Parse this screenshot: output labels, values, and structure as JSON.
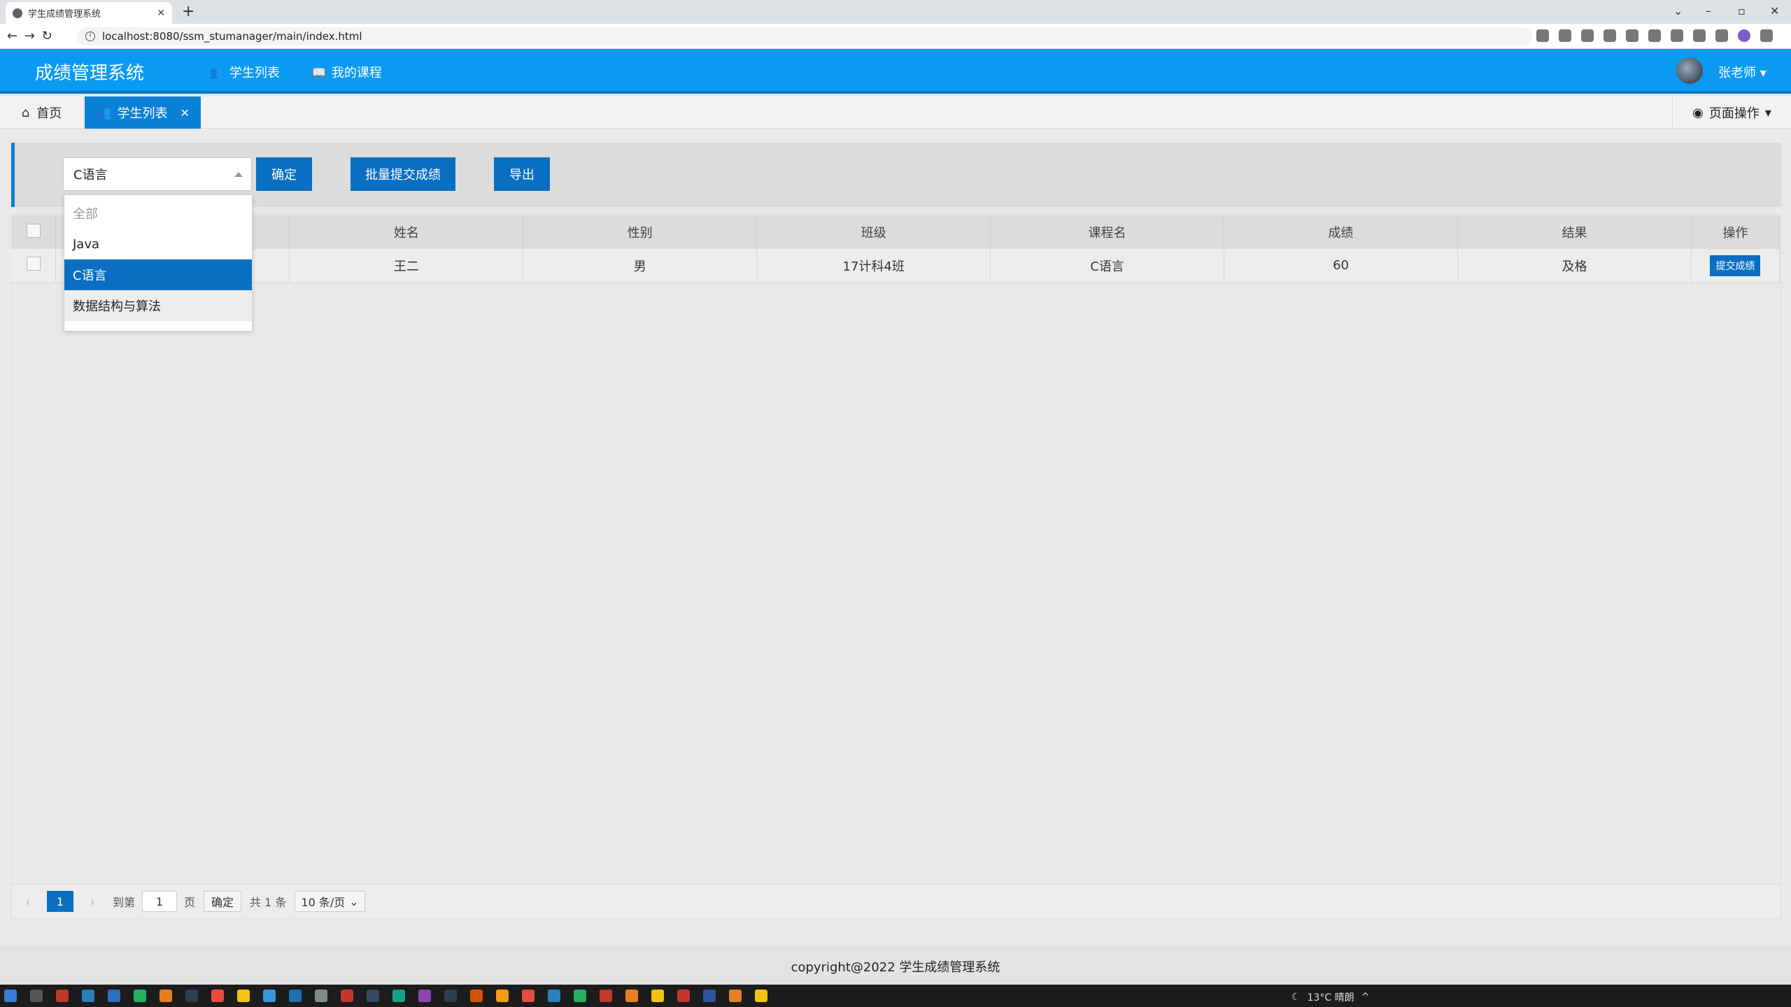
{
  "browser": {
    "tab_title": "学生成绩管理系统",
    "url": "localhost:8080/ssm_stumanager/main/index.html",
    "nav_glyphs": "← → ↻"
  },
  "header": {
    "app_title": "成绩管理系统",
    "nav": [
      {
        "label": "学生列表",
        "icon": "users-icon"
      },
      {
        "label": "我的课程",
        "icon": "book-icon"
      }
    ],
    "username": "张老师"
  },
  "tabs": {
    "home": "首页",
    "active": "学生列表",
    "page_ops": "页面操作"
  },
  "toolbar": {
    "course_select_value": "C语言",
    "confirm_label": "确定",
    "batch_submit_label": "批量提交成绩",
    "export_label": "导出"
  },
  "dropdown": {
    "options": [
      "全部",
      "Java",
      "C语言",
      "数据结构与算法"
    ],
    "selected": "C语言"
  },
  "table": {
    "headers": [
      "姓名",
      "性别",
      "班级",
      "课程名",
      "成绩",
      "结果",
      "操作"
    ],
    "rows": [
      {
        "name": "王二",
        "gender": "男",
        "class": "17计科4班",
        "course": "C语言",
        "score": "60",
        "result": "及格",
        "action": "提交成绩"
      }
    ]
  },
  "pager": {
    "current_page": "1",
    "goto_label": "到第",
    "goto_value": "1",
    "page_unit": "页",
    "confirm_label": "确定",
    "total": "共 1 条",
    "page_size": "10 条/页"
  },
  "footer": {
    "text": "copyright@2022 学生成绩管理系统"
  },
  "taskbar": {
    "weather": "13°C 晴朗"
  },
  "colors": {
    "header_blue": "#0a9af2",
    "primary_blue": "#0a6fc2",
    "tab_active_blue": "#0a7fd6"
  }
}
